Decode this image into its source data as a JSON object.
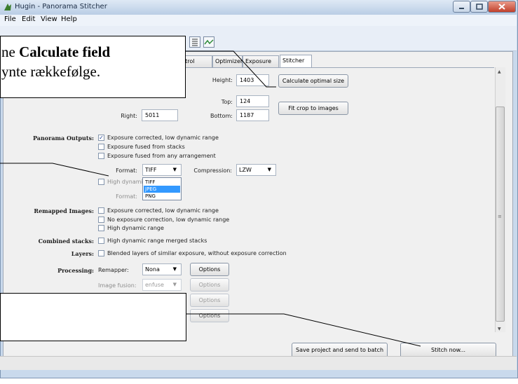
{
  "window": {
    "title": "Hugin - Panorama Stitcher"
  },
  "menu": [
    "File",
    "Edit",
    "View",
    "Help"
  ],
  "tabs": [
    "ntrol Points",
    "Optimizer",
    "Exposure",
    "Stitcher"
  ],
  "crop": {
    "right_label": "Right:",
    "right_value": "5011",
    "height_label": "Height:",
    "height_value": "1403",
    "top_label": "Top:",
    "top_value": "124",
    "bottom_label": "Bottom:",
    "bottom_value": "1187",
    "calc_button": "Calculate optimal size",
    "fit_button": "Fit crop to images"
  },
  "outputs": {
    "label": "Panorama Outputs:",
    "opt1": "Exposure corrected, low dynamic range",
    "opt2": "Exposure fused from stacks",
    "opt3": "Exposure fused from any arrangement",
    "format_label": "Format:",
    "format_value": "TIFF",
    "compression_label": "Compression:",
    "compression_value": "LZW",
    "hdr_text": "High dynamic",
    "format2_label": "Format:",
    "dropdown_options": [
      "TIFF",
      "JPEG",
      "PNG"
    ]
  },
  "remapped": {
    "label": "Remapped Images:",
    "opt1": "Exposure corrected, low dynamic range",
    "opt2": "No exposure correction, low dynamic range",
    "opt3": "High dynamic range"
  },
  "combined": {
    "label": "Combined stacks:",
    "opt": "High dynamic range merged stacks"
  },
  "layers": {
    "label": "Layers:",
    "opt": "Blended layers of similar exposure, without exposure correction"
  },
  "processing": {
    "label": "Processing:",
    "remapper_label": "Remapper:",
    "remapper_value": "Nona",
    "fusion_label": "Image fusion:",
    "fusion_value": "enfuse",
    "options": "Options"
  },
  "bottom": {
    "save_batch": "Save project and send to batch",
    "stitch": "Stitch now..."
  },
  "callouts": {
    "c1_prefix": "ne ",
    "c1_bold": "Calculate field",
    "c1_line2": "ynte rækkefølge."
  }
}
